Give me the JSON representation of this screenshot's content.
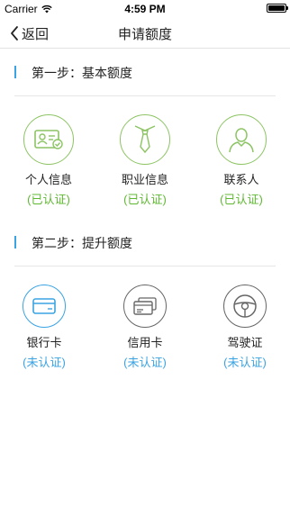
{
  "status_bar": {
    "carrier": "Carrier",
    "time": "4:59 PM"
  },
  "nav": {
    "back_label": "返回",
    "title": "申请额度"
  },
  "step1": {
    "title": "第一步：基本额度",
    "items": [
      {
        "label": "个人信息",
        "status": "(已认证)",
        "icon": "id-card-icon"
      },
      {
        "label": "职业信息",
        "status": "(已认证)",
        "icon": "tie-icon"
      },
      {
        "label": "联系人",
        "status": "(已认证)",
        "icon": "person-icon"
      }
    ]
  },
  "step2": {
    "title": "第二步：提升额度",
    "items": [
      {
        "label": "银行卡",
        "status": "(未认证)",
        "icon": "bank-card-icon"
      },
      {
        "label": "信用卡",
        "status": "(未认证)",
        "icon": "credit-card-icon"
      },
      {
        "label": "驾驶证",
        "status": "(未认证)",
        "icon": "steering-wheel-icon"
      }
    ]
  },
  "colors": {
    "accent_blue": "#3aa3e3",
    "verified_green": "#5fb832",
    "icon_green": "#8cc463"
  }
}
